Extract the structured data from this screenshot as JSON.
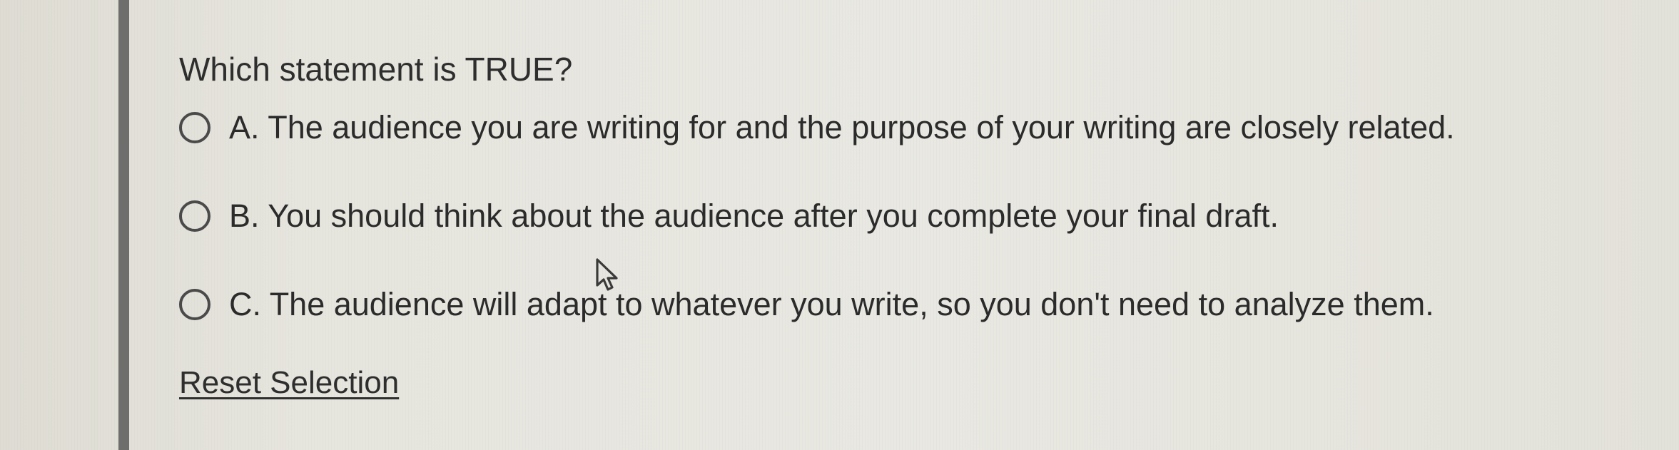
{
  "question": {
    "text": "Which statement is TRUE?"
  },
  "options": [
    {
      "label": "A. The audience you are writing for and the purpose of your writing are closely related.",
      "selected": false
    },
    {
      "label": "B. You should think about the audience after you complete your final draft.",
      "selected": false
    },
    {
      "label": "C. The audience will adapt to whatever you write, so you don't need to analyze them.",
      "selected": false
    }
  ],
  "actions": {
    "reset_label": "Reset Selection"
  },
  "icons": {
    "radio": "radio-unchecked-icon",
    "cursor": "mouse-pointer-icon"
  },
  "colors": {
    "border": "#6e6e6c",
    "text": "#2b2b2b",
    "background": "#e7e6df"
  }
}
